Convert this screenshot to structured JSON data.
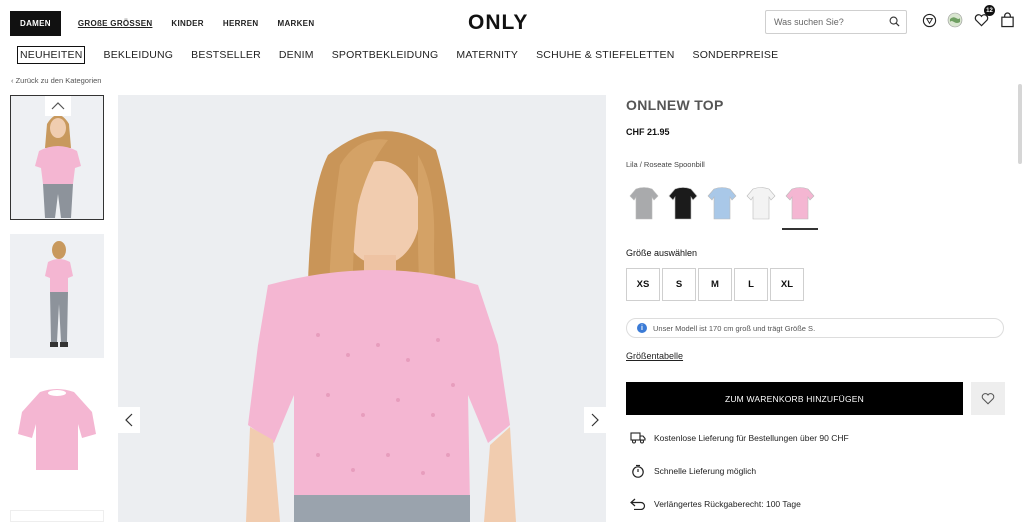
{
  "header": {
    "nav": [
      "DAMEN",
      "GROßE GRÖSSEN",
      "KINDER",
      "HERREN",
      "MARKEN"
    ],
    "logo": "ONLY",
    "search_placeholder": "Was suchen Sie?",
    "wishlist_count": "12",
    "icons": [
      "store-icon",
      "country-flag-icon",
      "heart-icon",
      "bag-icon"
    ]
  },
  "categories": [
    "NEUHEITEN",
    "BEKLEIDUNG",
    "BESTSELLER",
    "DENIM",
    "SPORTBEKLEIDUNG",
    "MATERNITY",
    "SCHUHE & STIEFELETTEN",
    "SONDERPREISE"
  ],
  "back_link": "Zurück zu den Kategorien",
  "product": {
    "name": "ONLNEW TOP",
    "price": "CHF 21.95",
    "color_label": "Lila / Roseate Spoonbill",
    "swatch_colors": [
      "#a9aaac",
      "#1b1b1b",
      "#a9c8e8",
      "#f3f3f3",
      "#f4b6d2"
    ],
    "size_label": "Größe auswählen",
    "sizes": [
      "XS",
      "S",
      "M",
      "L",
      "XL"
    ],
    "model_info": "Unser Modell ist 170 cm groß und trägt Größe S.",
    "size_table": "Größentabelle",
    "add_to_cart": "ZUM WARENKORB HINZUFÜGEN",
    "features": [
      {
        "icon": "truck-icon",
        "text": "Kostenlose Lieferung für Bestellungen über 90 CHF"
      },
      {
        "icon": "stopwatch-icon",
        "text": "Schnelle Lieferung möglich"
      },
      {
        "icon": "return-arrow-icon",
        "text": "Verlängertes Rückgaberecht: 100 Tage"
      }
    ]
  },
  "colors": {
    "accent": "#000000",
    "top_pink": "#f4b6d2",
    "info_blue": "#3b7bd6"
  }
}
